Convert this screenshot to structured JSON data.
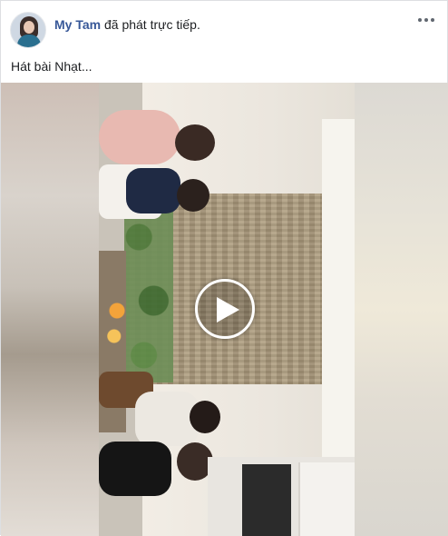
{
  "post": {
    "author": "My Tam",
    "action_text": " đã phát trực tiếp.",
    "caption": "Hát bài Nhạt...",
    "more_icon": "more-horizontal-icon",
    "avatar_icon": "profile-avatar"
  },
  "video": {
    "play_icon": "play-icon",
    "accent_color": "#385898"
  }
}
